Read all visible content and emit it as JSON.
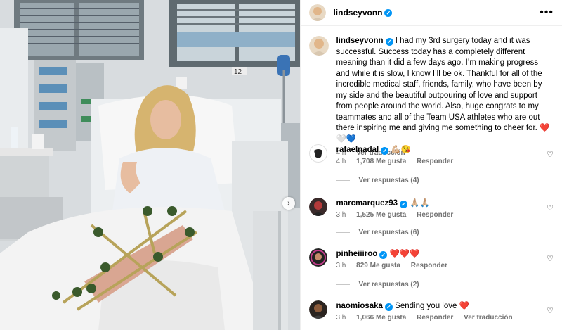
{
  "post": {
    "username": "lindseyvonn",
    "more_label": "•••",
    "caption": "I had my 3rd surgery today and it was successful. Success today has a completely different meaning than it did a few days ago. I’m making progress and while it is slow, I know I’ll be ok. Thankful for all of the incredible medical staff, friends, family, who have been by my side and the beautiful outpouring of love and support from people around the world. Also, huge congrats to my teammates and all of the Team USA athletes who are out there inspiring me and giving me something to cheer for. ❤️🤍💙",
    "time": "4 h",
    "see_translation": "Ver traducción"
  },
  "comments": [
    {
      "username": "rafaelnadal",
      "text": "💪🏼😘",
      "time": "4 h",
      "likes": "1,708 Me gusta",
      "reply": "Responder",
      "replies": "Ver respuestas (4)"
    },
    {
      "username": "marcmarquez93",
      "text": "🙏🏼🙏🏼",
      "time": "3 h",
      "likes": "1,525 Me gusta",
      "reply": "Responder",
      "replies": "Ver respuestas (6)"
    },
    {
      "username": "pinheiiiroo",
      "text": "❤️❤️❤️",
      "time": "3 h",
      "likes": "829 Me gusta",
      "reply": "Responder",
      "replies": "Ver respuestas (2)"
    },
    {
      "username": "naomiosaka",
      "text": "Sending you love ❤️",
      "time": "3 h",
      "likes": "1,066 Me gusta",
      "reply": "Responder",
      "see_translation": "Ver traducción"
    }
  ],
  "media": {
    "room_number": "12",
    "next_icon": "chevron-right-icon"
  },
  "colors": {
    "verified": "#0095f6",
    "meta": "#737373"
  }
}
